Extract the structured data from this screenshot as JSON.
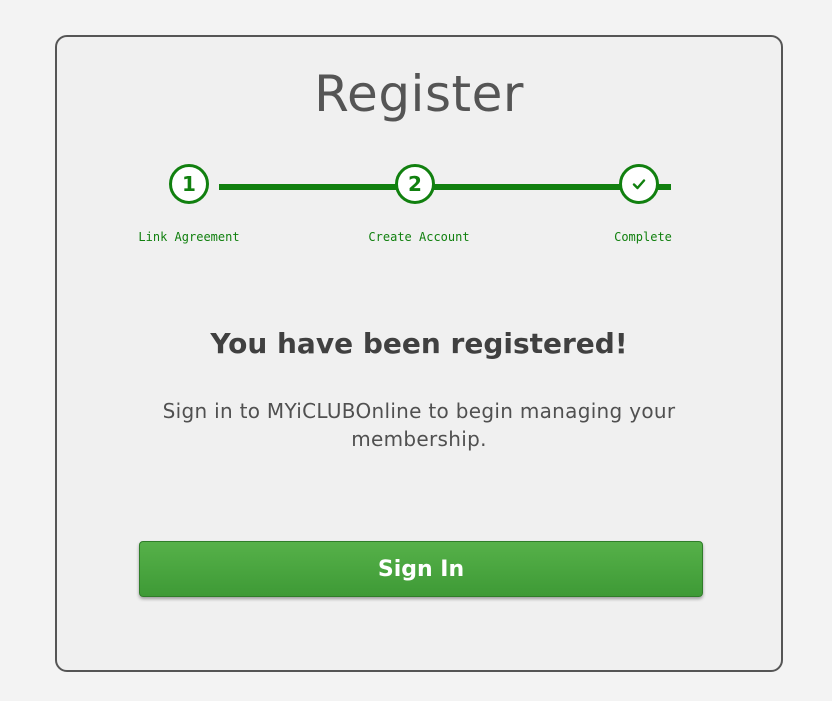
{
  "title": "Register",
  "steps": [
    {
      "marker": "1",
      "label": "Link Agreement"
    },
    {
      "marker": "2",
      "label": "Create Account"
    },
    {
      "marker": "",
      "label": "Complete"
    }
  ],
  "message": {
    "headline": "You have been registered!",
    "body": "Sign in to MYiCLUBOnline to begin managing your membership."
  },
  "button": {
    "label": "Sign In"
  },
  "colors": {
    "accent_green": "#11800f",
    "button_green": "#4aa63f",
    "card_border": "#555555",
    "background": "#f3f3f3"
  }
}
